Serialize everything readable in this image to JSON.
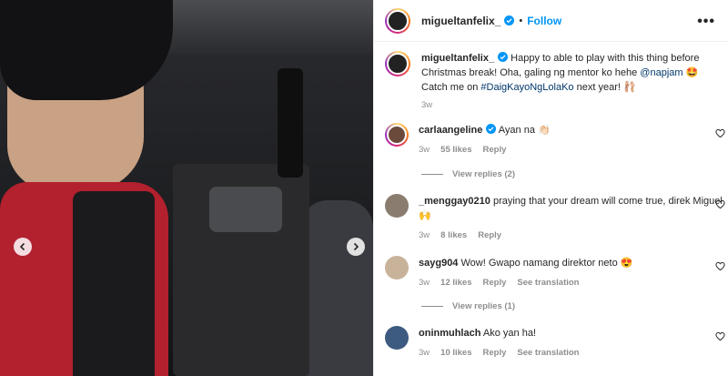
{
  "post": {
    "username": "migueltanfelix_",
    "follow_label": "Follow",
    "more_label": "•••"
  },
  "caption": {
    "username": "migueltanfelix_",
    "text_part1": "Happy to able to play with this thing before Christmas break! Oha, galing ng mentor ko hehe ",
    "mention": "@napjam",
    "text_part2": " 🤩 Catch me on ",
    "hashtag": "#DaigKayoNgLolaKo",
    "text_part3": " next year! 🩰",
    "time": "3w"
  },
  "comments": [
    {
      "username": "carlaangeline",
      "verified": true,
      "text": "Ayan na 👏🏻",
      "time": "3w",
      "likes": "55 likes",
      "reply": "Reply",
      "translation": ""
    },
    {
      "username": "_menggay0210",
      "verified": false,
      "text": "praying that your dream will come true, direk Miguel 🙌",
      "time": "3w",
      "likes": "8 likes",
      "reply": "Reply",
      "translation": ""
    },
    {
      "username": "sayg904",
      "verified": false,
      "text": "Wow! Gwapo namang direktor neto 😍",
      "time": "3w",
      "likes": "12 likes",
      "reply": "Reply",
      "translation": "See translation"
    },
    {
      "username": "oninmuhlach",
      "verified": false,
      "text": "Ako yan ha!",
      "time": "3w",
      "likes": "10 likes",
      "reply": "Reply",
      "translation": "See translation"
    }
  ],
  "view_replies": [
    "View replies (2)",
    "View replies (1)"
  ],
  "colors": {
    "follow": "#0095f6",
    "link": "#00376b",
    "muted": "#8e8e8e",
    "verified": "#0095f6"
  }
}
